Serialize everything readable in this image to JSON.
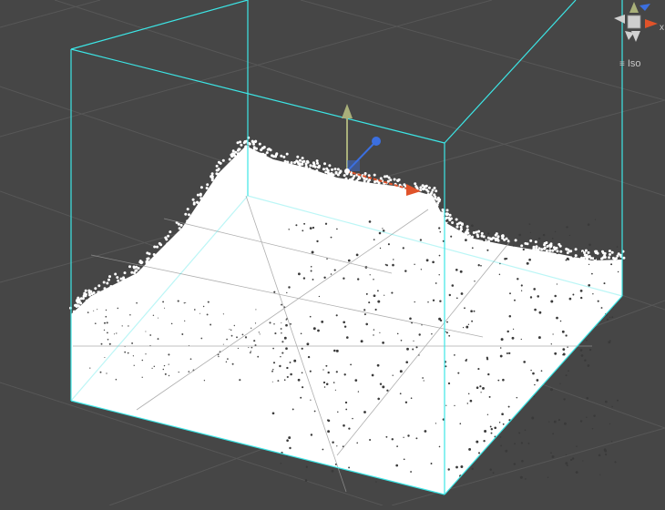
{
  "viewport": {
    "background": "#464646",
    "grid_color": "#555555",
    "bounds_color": "#3ce6e6",
    "particle_color": "#ffffff"
  },
  "gizmo": {
    "axis_x_label": "x",
    "axis_y_color": "#a9b07a",
    "axis_x_color": "#e0532a",
    "axis_z_color": "#3b6fe0",
    "projection": "Iso"
  }
}
